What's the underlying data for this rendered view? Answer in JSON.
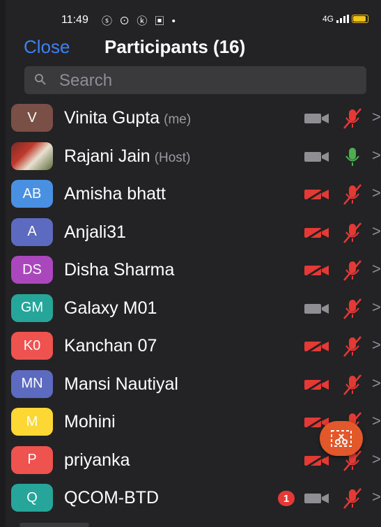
{
  "status_bar": {
    "time": "11:49",
    "notif_icons": "ⓢ ⊙ ⓚ ▣ •",
    "network": "4G",
    "colors": {
      "battery": "#f0c419"
    }
  },
  "header": {
    "close_label": "Close",
    "title": "Participants (16)"
  },
  "search": {
    "placeholder": "Search"
  },
  "colors": {
    "accent": "#3b82f6",
    "muted_red": "#e53935",
    "active_green": "#4caf50",
    "inactive_gray": "#8e8e93"
  },
  "participants": [
    {
      "initials": "V",
      "avatar_color": "#7a4f45",
      "name": "Vinita Gupta",
      "tag": "(me)",
      "video": "off-gray",
      "mic": "muted"
    },
    {
      "initials": "",
      "avatar_color": "photo",
      "name": "Rajani Jain",
      "tag": "(Host)",
      "video": "off-gray",
      "mic": "on"
    },
    {
      "initials": "AB",
      "avatar_color": "#4a90e2",
      "name": "Amisha bhatt",
      "tag": "",
      "video": "off-red",
      "mic": "muted"
    },
    {
      "initials": "A",
      "avatar_color": "#5c6bc0",
      "name": "Anjali31",
      "tag": "",
      "video": "off-red",
      "mic": "muted"
    },
    {
      "initials": "DS",
      "avatar_color": "#ab47bc",
      "name": "Disha Sharma",
      "tag": "",
      "video": "off-red",
      "mic": "muted"
    },
    {
      "initials": "GM",
      "avatar_color": "#26a69a",
      "name": "Galaxy M01",
      "tag": "",
      "video": "off-gray",
      "mic": "muted"
    },
    {
      "initials": "K0",
      "avatar_color": "#ef5350",
      "name": "Kanchan 07",
      "tag": "",
      "video": "off-red",
      "mic": "muted"
    },
    {
      "initials": "MN",
      "avatar_color": "#5c6bc0",
      "name": "Mansi Nautiyal",
      "tag": "",
      "video": "off-red",
      "mic": "muted"
    },
    {
      "initials": "M",
      "avatar_color": "#fdd835",
      "name": "Mohini",
      "tag": "",
      "video": "off-red",
      "mic": "muted"
    },
    {
      "initials": "P",
      "avatar_color": "#ef5350",
      "name": "priyanka",
      "tag": "",
      "video": "off-red",
      "mic": "muted"
    },
    {
      "initials": "Q",
      "avatar_color": "#26a69a",
      "name": "QCOM-BTD",
      "tag": "",
      "video": "off-gray",
      "mic": "muted",
      "badge": "1"
    }
  ],
  "fab": {
    "icon": "screenshot-scissors-icon"
  }
}
